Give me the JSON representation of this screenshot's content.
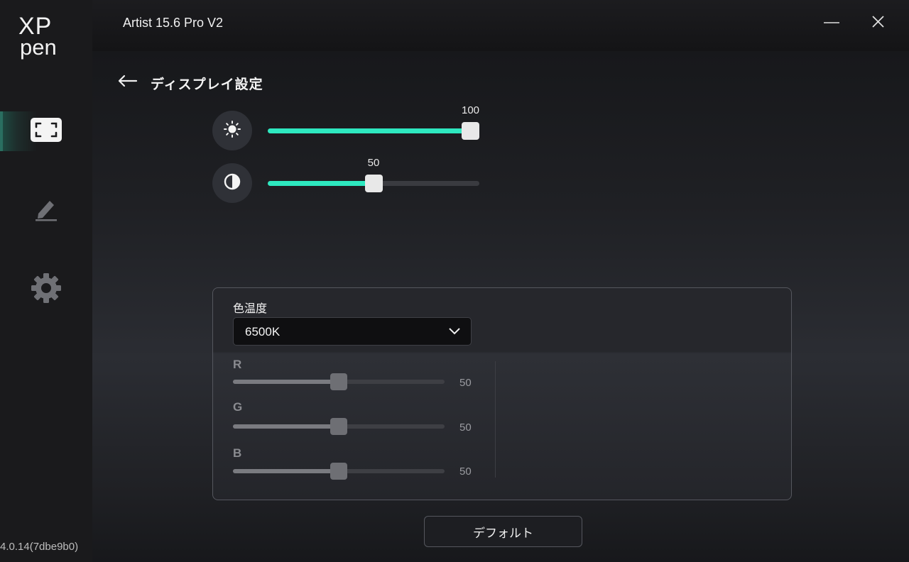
{
  "app": {
    "logo_line1": "XP",
    "logo_line2": "pen",
    "device_title": "Artist 15.6 Pro V2",
    "version": "4.0.14(7dbe9b0)"
  },
  "sidebar": {
    "items": [
      {
        "icon": "display-icon",
        "active": true
      },
      {
        "icon": "pen-icon",
        "active": false
      },
      {
        "icon": "gear-icon",
        "active": false
      }
    ]
  },
  "window_controls": {
    "minimize_icon": "minimize-icon",
    "close_icon": "close-icon"
  },
  "header": {
    "back_icon": "back-arrow-icon",
    "title": "ディスプレイ設定"
  },
  "brightness": {
    "icon": "brightness-icon",
    "value": "100",
    "level": 100
  },
  "contrast": {
    "icon": "contrast-icon",
    "value": "50",
    "level": 50
  },
  "color_temperature": {
    "label": "色温度",
    "selected": "6500K",
    "channels": [
      {
        "name": "R",
        "value": "50",
        "level": 50
      },
      {
        "name": "G",
        "value": "50",
        "level": 50
      },
      {
        "name": "B",
        "value": "50",
        "level": 50
      }
    ]
  },
  "footer": {
    "default_label": "デフォルト"
  },
  "colors": {
    "accent": "#2ee8c0",
    "background": "#15161a",
    "sidebar": "#1a1a1c"
  }
}
